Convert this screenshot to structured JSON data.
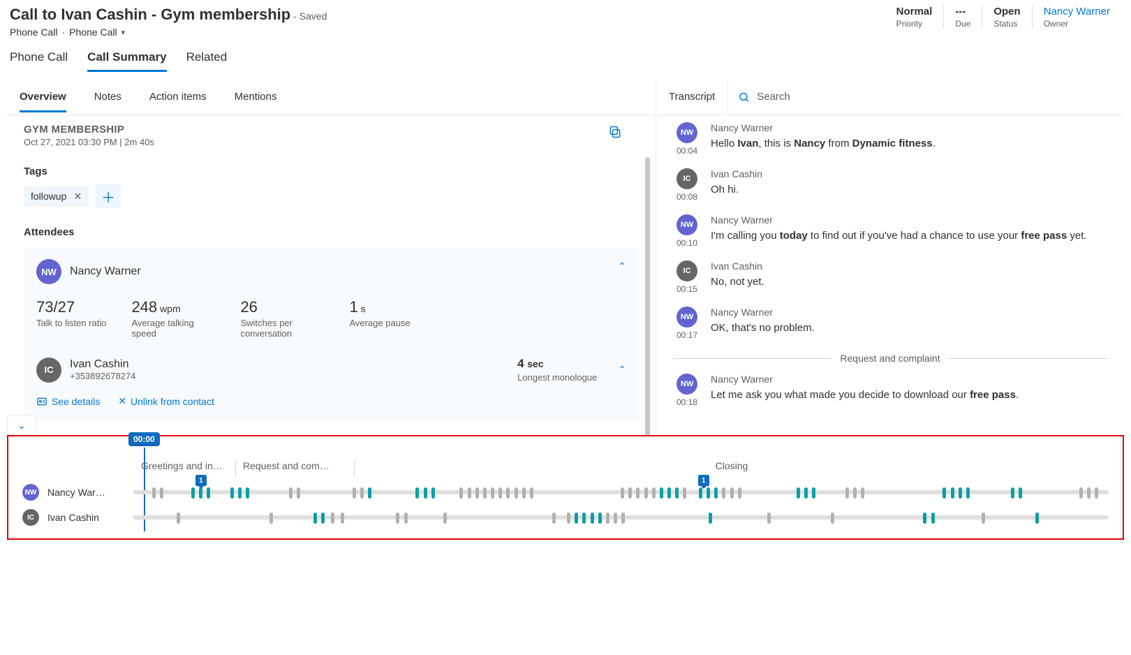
{
  "header": {
    "title": "Call to Ivan Cashin - Gym membership",
    "saved": "- Saved",
    "sub_a": "Phone Call",
    "sub_sep": "·",
    "sub_b": "Phone Call",
    "meta": [
      {
        "value": "Normal",
        "label": "Priority"
      },
      {
        "value": "---",
        "label": "Due"
      },
      {
        "value": "Open",
        "label": "Status"
      },
      {
        "value": "Nancy Warner",
        "label": "Owner",
        "owner": true
      }
    ]
  },
  "topTabs": [
    "Phone Call",
    "Call Summary",
    "Related"
  ],
  "secTabs": [
    "Overview",
    "Notes",
    "Action items",
    "Mentions"
  ],
  "overview": {
    "title": "GYM MEMBERSHIP",
    "meta": "Oct 27, 2021 03:30 PM  |  2m 40s",
    "tagsLabel": "Tags",
    "tag": "followup",
    "attendeesLabel": "Attendees",
    "attendee1": {
      "initials": "NW",
      "name": "Nancy Warner",
      "stats": [
        {
          "val": "73/27",
          "unit": "",
          "label": "Talk to listen ratio"
        },
        {
          "val": "248",
          "unit": "wpm",
          "label": "Average talking speed"
        },
        {
          "val": "26",
          "unit": "",
          "label": "Switches per conversation"
        },
        {
          "val": "1",
          "unit": "s",
          "label": "Average pause"
        }
      ]
    },
    "attendee2": {
      "initials": "IC",
      "name": "Ivan Cashin",
      "phone": "+353892678274",
      "mono_val": "4",
      "mono_unit": "sec",
      "mono_label": "Longest monologue"
    },
    "links": {
      "details": "See details",
      "unlink": "Unlink from contact"
    }
  },
  "transcript": {
    "title": "Transcript",
    "searchPlaceholder": "Search",
    "divider": "Request and complaint",
    "msgs": [
      {
        "who": "NW",
        "cl": "nw",
        "name": "Nancy Warner",
        "time": "00:04",
        "html": "Hello <b>Ivan</b>, this is <b>Nancy</b> from <b>Dynamic fitness</b>."
      },
      {
        "who": "IC",
        "cl": "ic",
        "name": "Ivan Cashin",
        "time": "00:08",
        "html": "Oh hi."
      },
      {
        "who": "NW",
        "cl": "nw",
        "name": "Nancy Warner",
        "time": "00:10",
        "html": "I'm calling you <b>today</b> to find out if you've had a chance to use your <b>free pass</b> yet."
      },
      {
        "who": "IC",
        "cl": "ic",
        "name": "Ivan Cashin",
        "time": "00:15",
        "html": "No, not yet."
      },
      {
        "who": "NW",
        "cl": "nw",
        "name": "Nancy Warner",
        "time": "00:17",
        "html": "OK, that's no problem."
      },
      {
        "div": true
      },
      {
        "who": "NW",
        "cl": "nw",
        "name": "Nancy Warner",
        "time": "00:18",
        "html": "Let me ask you what made you decide to download our <b>free pass</b>."
      }
    ]
  },
  "timeline": {
    "playhead": "00:00",
    "segs": [
      "Greetings and in…",
      "Request and com…",
      "Closing"
    ],
    "tracks": [
      {
        "initials": "NW",
        "cl": "nw",
        "name": "Nancy War…",
        "markers": [
          7,
          58.5
        ],
        "blips": [
          {
            "p": 2.0,
            "c": "g"
          },
          {
            "p": 2.8,
            "c": "g"
          },
          {
            "p": 6.0,
            "c": "t"
          },
          {
            "p": 6.8,
            "c": "t"
          },
          {
            "p": 7.6,
            "c": "t"
          },
          {
            "p": 10.0,
            "c": "t"
          },
          {
            "p": 10.8,
            "c": "t"
          },
          {
            "p": 11.6,
            "c": "t"
          },
          {
            "p": 16.0,
            "c": "g"
          },
          {
            "p": 16.8,
            "c": "g"
          },
          {
            "p": 22.5,
            "c": "g"
          },
          {
            "p": 23.3,
            "c": "g"
          },
          {
            "p": 24.1,
            "c": "t"
          },
          {
            "p": 29.0,
            "c": "t"
          },
          {
            "p": 29.8,
            "c": "t"
          },
          {
            "p": 30.6,
            "c": "t"
          },
          {
            "p": 33.5,
            "c": "g"
          },
          {
            "p": 34.3,
            "c": "g"
          },
          {
            "p": 35.1,
            "c": "g"
          },
          {
            "p": 35.9,
            "c": "g"
          },
          {
            "p": 36.7,
            "c": "g"
          },
          {
            "p": 37.5,
            "c": "g"
          },
          {
            "p": 38.3,
            "c": "g"
          },
          {
            "p": 39.1,
            "c": "g"
          },
          {
            "p": 39.9,
            "c": "g"
          },
          {
            "p": 40.7,
            "c": "g"
          },
          {
            "p": 50.0,
            "c": "g"
          },
          {
            "p": 50.8,
            "c": "g"
          },
          {
            "p": 51.6,
            "c": "g"
          },
          {
            "p": 52.4,
            "c": "g"
          },
          {
            "p": 53.2,
            "c": "g"
          },
          {
            "p": 54.0,
            "c": "t"
          },
          {
            "p": 54.8,
            "c": "t"
          },
          {
            "p": 55.6,
            "c": "t"
          },
          {
            "p": 56.4,
            "c": "g"
          },
          {
            "p": 58.0,
            "c": "t"
          },
          {
            "p": 58.8,
            "c": "t"
          },
          {
            "p": 59.6,
            "c": "t"
          },
          {
            "p": 60.4,
            "c": "g"
          },
          {
            "p": 61.2,
            "c": "g"
          },
          {
            "p": 62.0,
            "c": "g"
          },
          {
            "p": 68.0,
            "c": "t"
          },
          {
            "p": 68.8,
            "c": "t"
          },
          {
            "p": 69.6,
            "c": "t"
          },
          {
            "p": 73.0,
            "c": "g"
          },
          {
            "p": 73.8,
            "c": "g"
          },
          {
            "p": 74.6,
            "c": "g"
          },
          {
            "p": 83.0,
            "c": "t"
          },
          {
            "p": 83.8,
            "c": "t"
          },
          {
            "p": 84.6,
            "c": "t"
          },
          {
            "p": 85.4,
            "c": "t"
          },
          {
            "p": 90.0,
            "c": "t"
          },
          {
            "p": 90.8,
            "c": "t"
          },
          {
            "p": 97.0,
            "c": "g"
          },
          {
            "p": 97.8,
            "c": "g"
          },
          {
            "p": 98.6,
            "c": "g"
          }
        ]
      },
      {
        "initials": "IC",
        "cl": "ic",
        "name": "Ivan Cashin",
        "markers": [],
        "blips": [
          {
            "p": 4.5,
            "c": "g"
          },
          {
            "p": 14.0,
            "c": "g"
          },
          {
            "p": 18.5,
            "c": "t"
          },
          {
            "p": 19.3,
            "c": "t"
          },
          {
            "p": 20.3,
            "c": "g"
          },
          {
            "p": 21.3,
            "c": "g"
          },
          {
            "p": 27.0,
            "c": "g"
          },
          {
            "p": 27.8,
            "c": "g"
          },
          {
            "p": 31.8,
            "c": "g"
          },
          {
            "p": 43.0,
            "c": "g"
          },
          {
            "p": 44.5,
            "c": "g"
          },
          {
            "p": 45.3,
            "c": "t"
          },
          {
            "p": 46.1,
            "c": "t"
          },
          {
            "p": 46.9,
            "c": "t"
          },
          {
            "p": 47.7,
            "c": "t"
          },
          {
            "p": 48.5,
            "c": "g"
          },
          {
            "p": 49.3,
            "c": "g"
          },
          {
            "p": 50.1,
            "c": "g"
          },
          {
            "p": 59.0,
            "c": "t"
          },
          {
            "p": 65.0,
            "c": "g"
          },
          {
            "p": 71.5,
            "c": "g"
          },
          {
            "p": 81.0,
            "c": "t"
          },
          {
            "p": 81.8,
            "c": "t"
          },
          {
            "p": 87.0,
            "c": "g"
          },
          {
            "p": 92.5,
            "c": "t"
          }
        ]
      }
    ]
  }
}
